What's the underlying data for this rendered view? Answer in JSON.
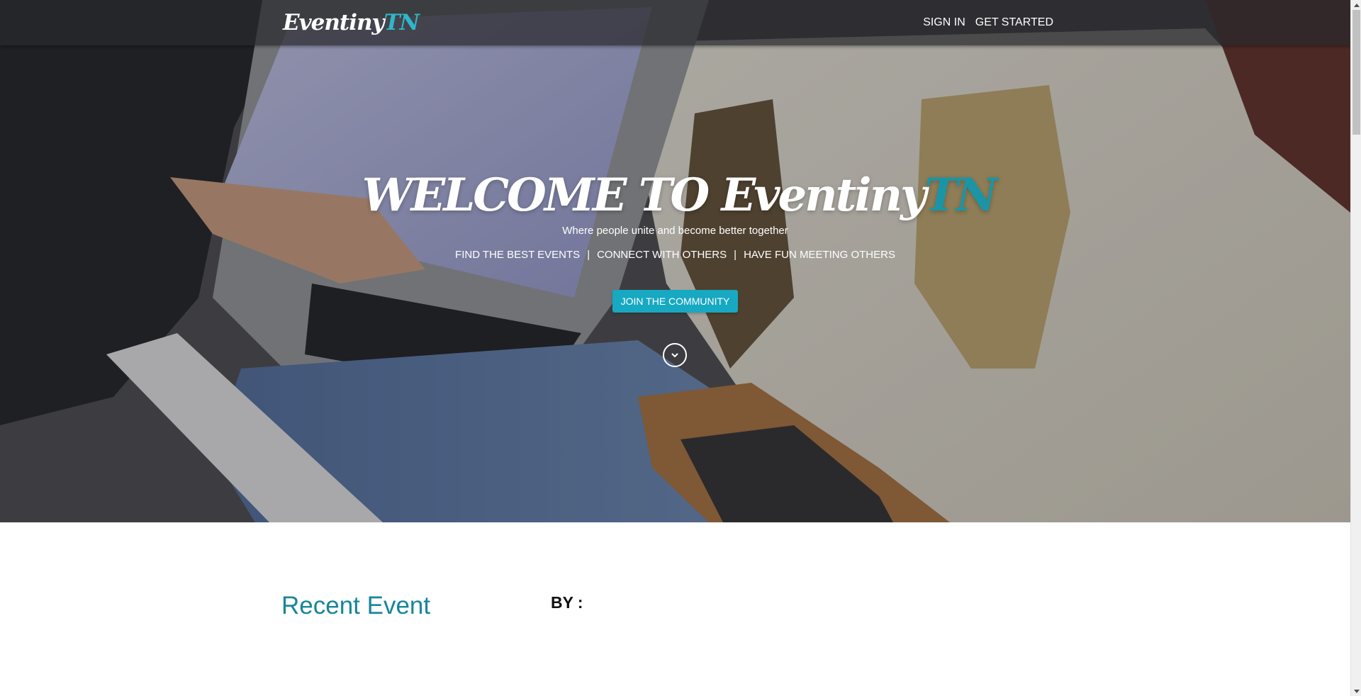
{
  "nav": {
    "brand_main": "Eventiny",
    "brand_accent": "TN",
    "links": [
      {
        "label": "SIGN IN"
      },
      {
        "label": "GET STARTED"
      }
    ]
  },
  "hero": {
    "title_main": "WELCOME TO Eventiny",
    "title_accent": "TN",
    "subtitle": "Where people unite and become better together",
    "features": [
      "FIND THE BEST EVENTS",
      "CONNECT WITH OTHERS",
      "HAVE FUN MEETING OTHERS"
    ],
    "separator": "|",
    "cta_label": "JOIN THE COMMUNITY",
    "scroll_icon": "chevron-down-icon"
  },
  "main": {
    "section_title": "Recent Event",
    "by_label": "BY :"
  },
  "colors": {
    "accent": "#2fb7c7",
    "button": "#17a8c2",
    "section_title": "#17869a"
  }
}
